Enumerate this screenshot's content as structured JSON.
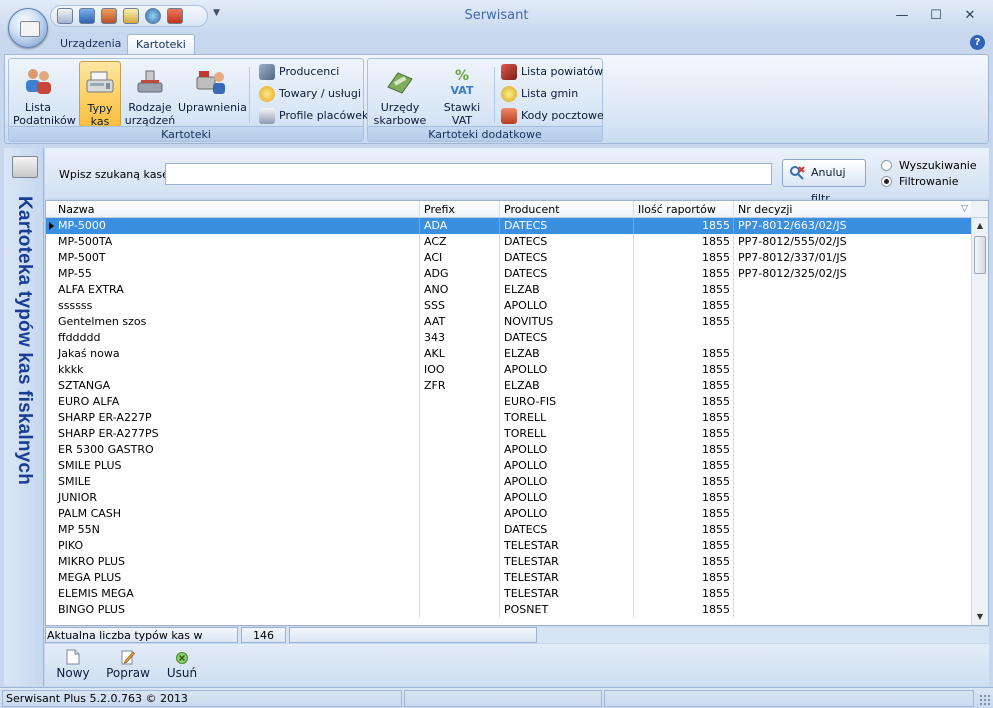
{
  "window": {
    "title": "Serwisant",
    "controls": {
      "minimize": "—",
      "maximize": "☐",
      "close": "✕"
    }
  },
  "ribbon": {
    "tabs": [
      "Urządzenia",
      "Kartoteki"
    ],
    "active_tab": "Kartoteki",
    "groups": {
      "kartoteki": {
        "label": "Kartoteki",
        "big_buttons": [
          {
            "label": "Lista Podatników",
            "icon": "users-icon"
          },
          {
            "label": "Typy kas",
            "icon": "cash-register-icon"
          },
          {
            "label": "Rodzaje urządzeń",
            "icon": "scale-icon"
          },
          {
            "label": "Uprawnienia",
            "icon": "person-register-icon"
          }
        ],
        "small_buttons": [
          {
            "label": "Producenci",
            "icon": "tools-icon"
          },
          {
            "label": "Towary / usługi",
            "icon": "goods-icon"
          },
          {
            "label": "Profile placówek",
            "icon": "house-icon"
          }
        ]
      },
      "dodatkowe": {
        "label": "Kartoteki dodatkowe",
        "big_buttons": [
          {
            "label": "Urzędy skarbowe",
            "icon": "tax-office-icon"
          },
          {
            "label": "Stawki VAT",
            "icon": "vat-icon"
          }
        ],
        "small_buttons": [
          {
            "label": "Lista powiatów",
            "icon": "county-icon"
          },
          {
            "label": "Lista gmin",
            "icon": "commune-icon"
          },
          {
            "label": "Kody pocztowe",
            "icon": "postal-code-icon"
          }
        ]
      }
    }
  },
  "side_panel": {
    "title": "Kartoteka typów kas fiskalnych"
  },
  "search": {
    "label": "Wpisz szukaną kasę",
    "value": "",
    "clear_filter_label": "Anuluj filtr",
    "mode_options": [
      "Wyszukiwanie",
      "Filtrowanie"
    ],
    "selected_mode": "Filtrowanie"
  },
  "table": {
    "columns": [
      "Nazwa",
      "Prefix",
      "Producent",
      "Ilość raportów",
      "Nr decyzji"
    ],
    "rows": [
      [
        "MP-5000",
        "ADA",
        "DATECS",
        "1855",
        "PP7-8012/663/02/JS"
      ],
      [
        "MP-500TA",
        "ACZ",
        "DATECS",
        "1855",
        "PP7-8012/555/02/JS"
      ],
      [
        "MP-500T",
        "ACI",
        "DATECS",
        "1855",
        "PP7-8012/337/01/JS"
      ],
      [
        "MP-55",
        "ADG",
        "DATECS",
        "1855",
        "PP7-8012/325/02/JS"
      ],
      [
        "ALFA EXTRA",
        "ANO",
        "ELZAB",
        "1855",
        ""
      ],
      [
        "ssssss",
        "SSS",
        "APOLLO",
        "1855",
        ""
      ],
      [
        "Gentelmen szos",
        "AAT",
        "NOVITUS",
        "1855",
        ""
      ],
      [
        "ffddddd",
        "343",
        "DATECS",
        "",
        ""
      ],
      [
        "Jakaś nowa",
        "AKL",
        "ELZAB",
        "1855",
        ""
      ],
      [
        "kkkk",
        "IOO",
        "APOLLO",
        "1855",
        ""
      ],
      [
        "SZTANGA",
        "ZFR",
        "ELZAB",
        "1855",
        ""
      ],
      [
        "EURO ALFA",
        "",
        "EURO-FIS",
        "1855",
        ""
      ],
      [
        "SHARP ER-A227P",
        "",
        "TORELL",
        "1855",
        ""
      ],
      [
        "SHARP ER-A277PS",
        "",
        "TORELL",
        "1855",
        ""
      ],
      [
        "ER 5300 GASTRO",
        "",
        "APOLLO",
        "1855",
        ""
      ],
      [
        "SMILE PLUS",
        "",
        "APOLLO",
        "1855",
        ""
      ],
      [
        "SMILE",
        "",
        "APOLLO",
        "1855",
        ""
      ],
      [
        "JUNIOR",
        "",
        "APOLLO",
        "1855",
        ""
      ],
      [
        "PALM CASH",
        "",
        "APOLLO",
        "1855",
        ""
      ],
      [
        "MP 55N",
        "",
        "DATECS",
        "1855",
        ""
      ],
      [
        "PIKO",
        "",
        "TELESTAR",
        "1855",
        ""
      ],
      [
        "MIKRO PLUS",
        "",
        "TELESTAR",
        "1855",
        ""
      ],
      [
        "MEGA PLUS",
        "",
        "TELESTAR",
        "1855",
        ""
      ],
      [
        "ELEMIS MEGA",
        "",
        "TELESTAR",
        "1855",
        ""
      ],
      [
        "BINGO PLUS",
        "",
        "POSNET",
        "1855",
        ""
      ]
    ],
    "selected_row": 0
  },
  "count": {
    "label": "Aktualna liczba typów kas w tabeli:",
    "value": "146"
  },
  "actions": [
    {
      "label": "Nowy",
      "icon": "new-document-icon"
    },
    {
      "label": "Popraw",
      "icon": "edit-icon"
    },
    {
      "label": "Usuń",
      "icon": "delete-icon"
    }
  ],
  "status": {
    "version": "Serwisant Plus 5.2.0.763 © 2013"
  }
}
